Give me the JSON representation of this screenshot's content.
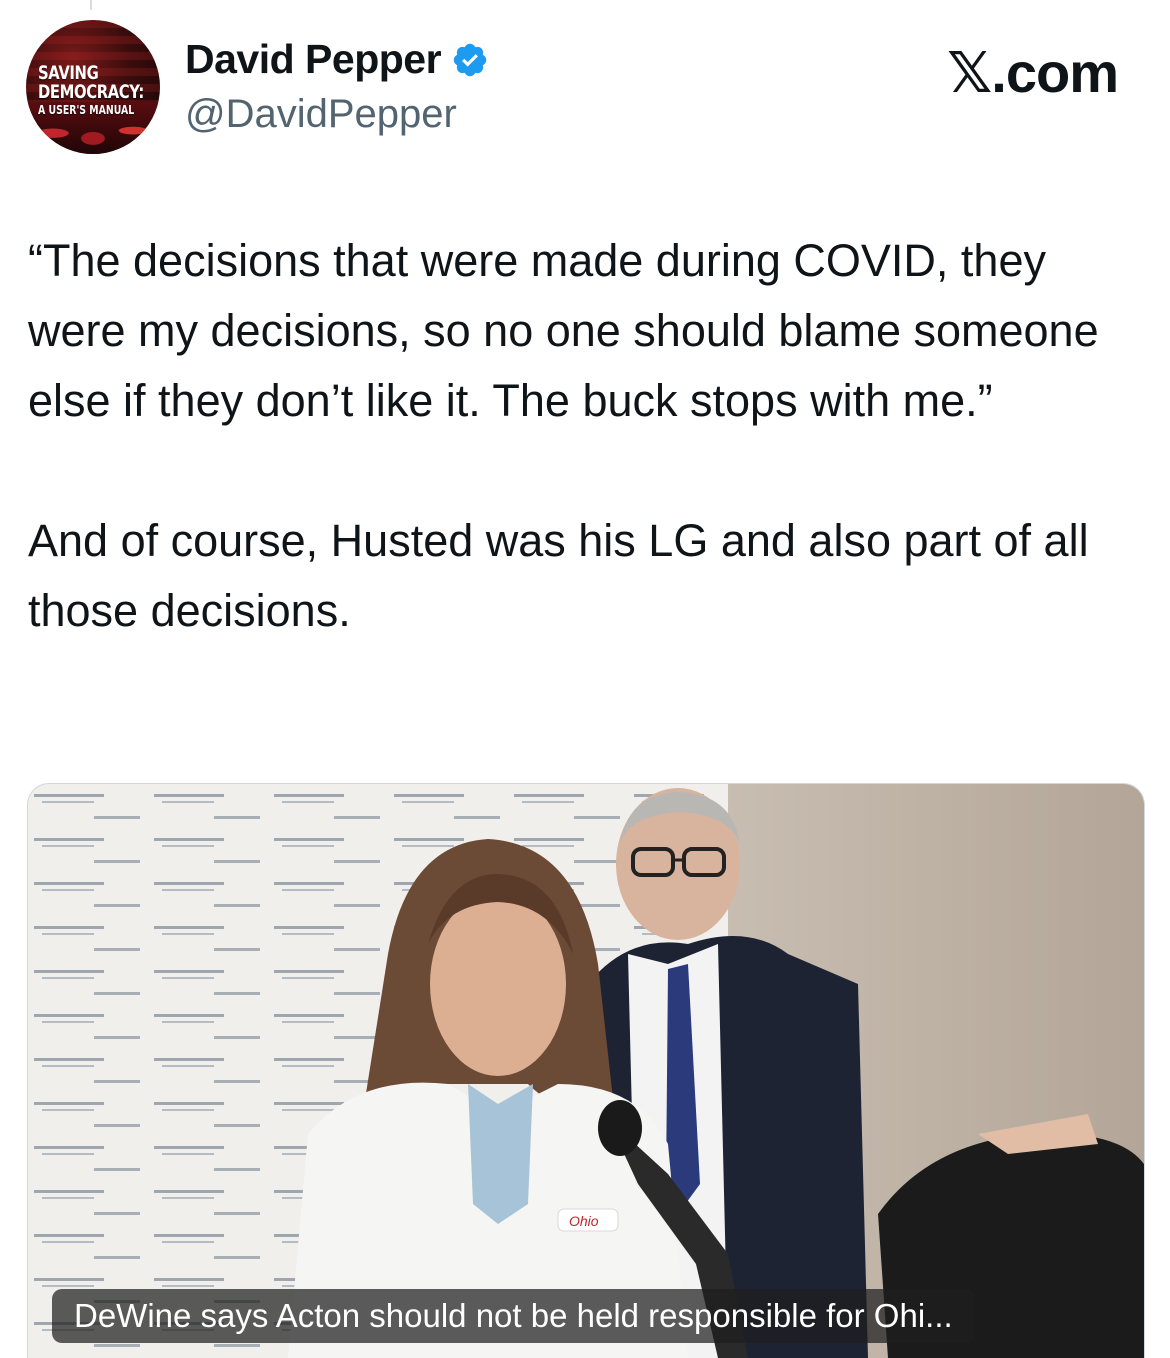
{
  "author": {
    "display_name": "David Pepper",
    "handle": "@DavidPepper",
    "verified": true,
    "avatar_text": [
      "SAVING",
      "DEMOCRACY:",
      "A USER'S MANUAL"
    ]
  },
  "source_label": "𝕏.com",
  "tweet": {
    "paragraphs": [
      "“The decisions that were made during COVID, they were my decisions, so no one should blame someone else if they don’t like it. The buck stops with me.”",
      "And of course, Husted was his LG and also part of all those decisions."
    ]
  },
  "media": {
    "type": "video",
    "caption": "DeWine says Acton should not be held responsible for Ohi...",
    "badge_text": "Ohio"
  },
  "colors": {
    "verified": "#1d9bf0",
    "text": "#0f1419",
    "secondary_text": "#536471",
    "border": "#cfd9de"
  }
}
